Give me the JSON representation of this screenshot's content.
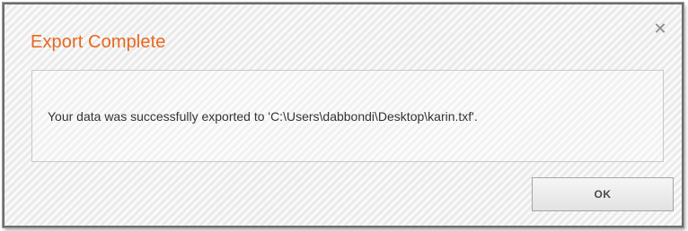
{
  "dialog": {
    "title": "Export Complete",
    "close_icon": "close-icon",
    "message": "Your data was successfully exported to 'C:\\Users\\dabbondi\\Desktop\\karin.txf'.",
    "ok_label": "OK"
  },
  "colors": {
    "title": "#e8681e",
    "border": "#6e6e6e"
  }
}
